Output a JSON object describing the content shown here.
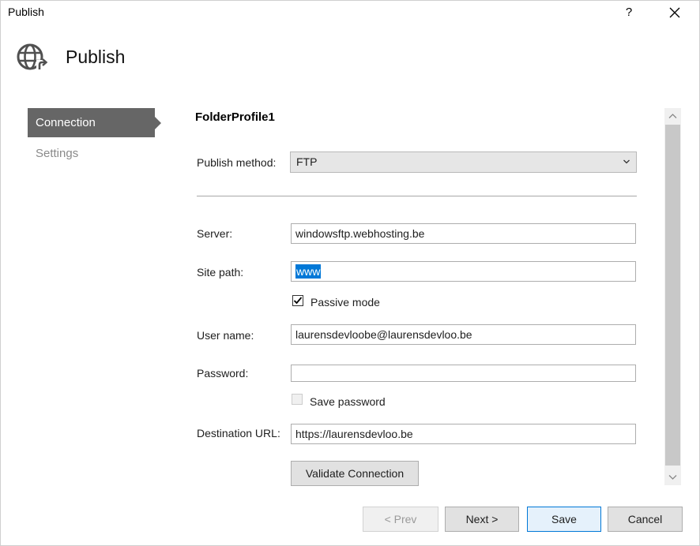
{
  "window": {
    "title": "Publish",
    "help_label": "?"
  },
  "header": {
    "title": "Publish",
    "icon": "globe-publish-icon"
  },
  "sidebar": {
    "items": [
      {
        "label": "Connection",
        "active": true
      },
      {
        "label": "Settings",
        "active": false
      }
    ]
  },
  "profile": {
    "name": "FolderProfile1"
  },
  "form": {
    "publish_method": {
      "label": "Publish method:",
      "value": "FTP"
    },
    "server": {
      "label": "Server:",
      "value": "windowsftp.webhosting.be"
    },
    "site_path": {
      "label": "Site path:",
      "value": "www"
    },
    "passive_mode": {
      "label": "Passive mode",
      "checked": true
    },
    "user_name": {
      "label": "User name:",
      "value": "laurensdevloobe@laurensdevloo.be"
    },
    "password": {
      "label": "Password:",
      "value": ""
    },
    "save_password": {
      "label": "Save password",
      "checked": false,
      "enabled": false
    },
    "destination_url": {
      "label": "Destination URL:",
      "value": "https://laurensdevloo.be"
    },
    "validate_label": "Validate Connection"
  },
  "footer": {
    "prev_label": "< Prev",
    "next_label": "Next >",
    "save_label": "Save",
    "cancel_label": "Cancel"
  },
  "colors": {
    "nav_active_bg": "#666666",
    "selection_bg": "#0078d7",
    "primary_border": "#0078d7"
  }
}
